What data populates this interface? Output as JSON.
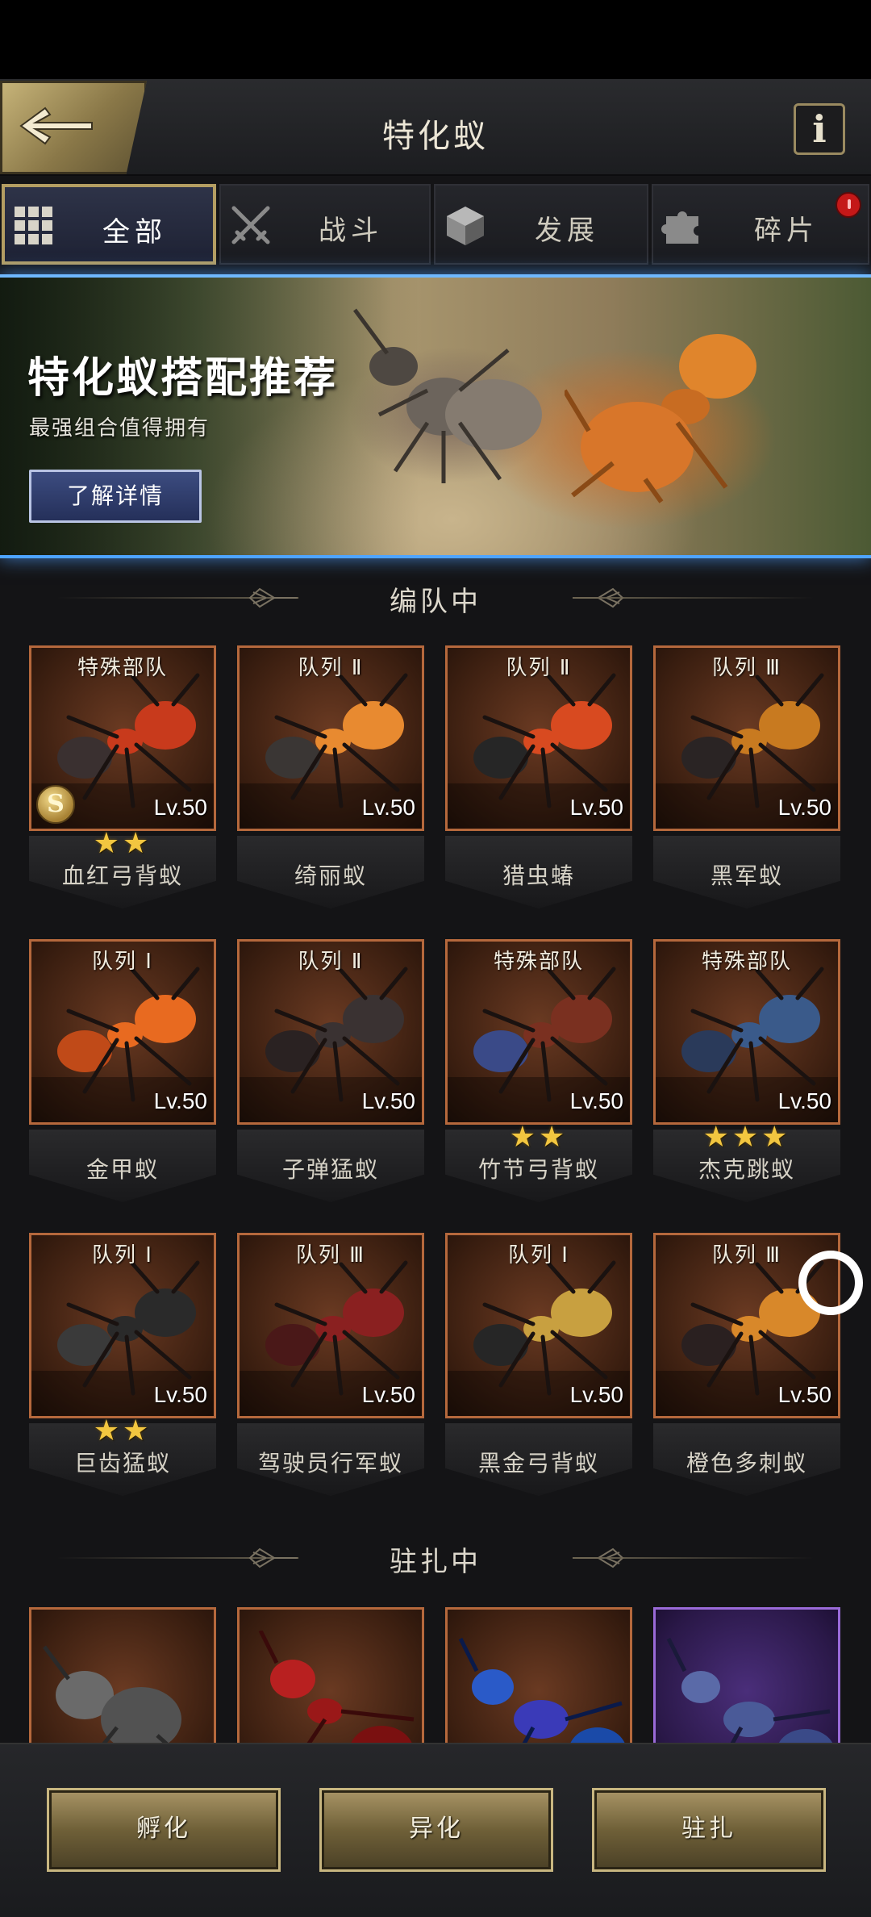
{
  "header": {
    "title": "特化蚁",
    "back_icon": "arrow-left-icon",
    "info_label": "i"
  },
  "tabs": [
    {
      "label": "全部",
      "icon": "grid-icon",
      "active": true
    },
    {
      "label": "战斗",
      "icon": "crossed-swords-icon",
      "active": false
    },
    {
      "label": "发展",
      "icon": "cube-icon",
      "active": false
    },
    {
      "label": "碎片",
      "icon": "puzzle-piece-icon",
      "active": false,
      "badge": "!"
    }
  ],
  "banner": {
    "title": "特化蚁搭配推荐",
    "subtitle": "最强组合值得拥有",
    "button_label": "了解详情"
  },
  "sections": {
    "in_formation": "编队中",
    "garrisoned": "驻扎中"
  },
  "formation_cards": [
    {
      "team": "特殊部队",
      "level": "Lv.50",
      "name": "血红弓背蚁",
      "stars": "★★",
      "badge": "S"
    },
    {
      "team": "队列 Ⅱ",
      "level": "Lv.50",
      "name": "绮丽蚁",
      "stars": ""
    },
    {
      "team": "队列 Ⅱ",
      "level": "Lv.50",
      "name": "猎虫蝽",
      "stars": ""
    },
    {
      "team": "队列 Ⅲ",
      "level": "Lv.50",
      "name": "黑军蚁",
      "stars": ""
    },
    {
      "team": "队列 Ⅰ",
      "level": "Lv.50",
      "name": "金甲蚁",
      "stars": ""
    },
    {
      "team": "队列 Ⅱ",
      "level": "Lv.50",
      "name": "子弹猛蚁",
      "stars": ""
    },
    {
      "team": "特殊部队",
      "level": "Lv.50",
      "name": "竹节弓背蚁",
      "stars": "★★"
    },
    {
      "team": "特殊部队",
      "level": "Lv.50",
      "name": "杰克跳蚁",
      "stars": "★★★"
    },
    {
      "team": "队列 Ⅰ",
      "level": "Lv.50",
      "name": "巨齿猛蚁",
      "stars": "★★"
    },
    {
      "team": "队列 Ⅲ",
      "level": "Lv.50",
      "name": "驾驶员行军蚁",
      "stars": ""
    },
    {
      "team": "队列 Ⅰ",
      "level": "Lv.50",
      "name": "黑金弓背蚁",
      "stars": ""
    },
    {
      "team": "队列 Ⅲ",
      "level": "Lv.50",
      "name": "橙色多刺蚁",
      "stars": ""
    }
  ],
  "bottom_buttons": [
    {
      "label": "孵化"
    },
    {
      "label": "异化"
    },
    {
      "label": "驻扎"
    }
  ],
  "colors": {
    "accent_gold": "#b49e62",
    "card_border": "#b5683c",
    "card_border_purple": "#9a6ad8",
    "banner_glow": "#4ea4ff",
    "star": "#f2c640"
  }
}
